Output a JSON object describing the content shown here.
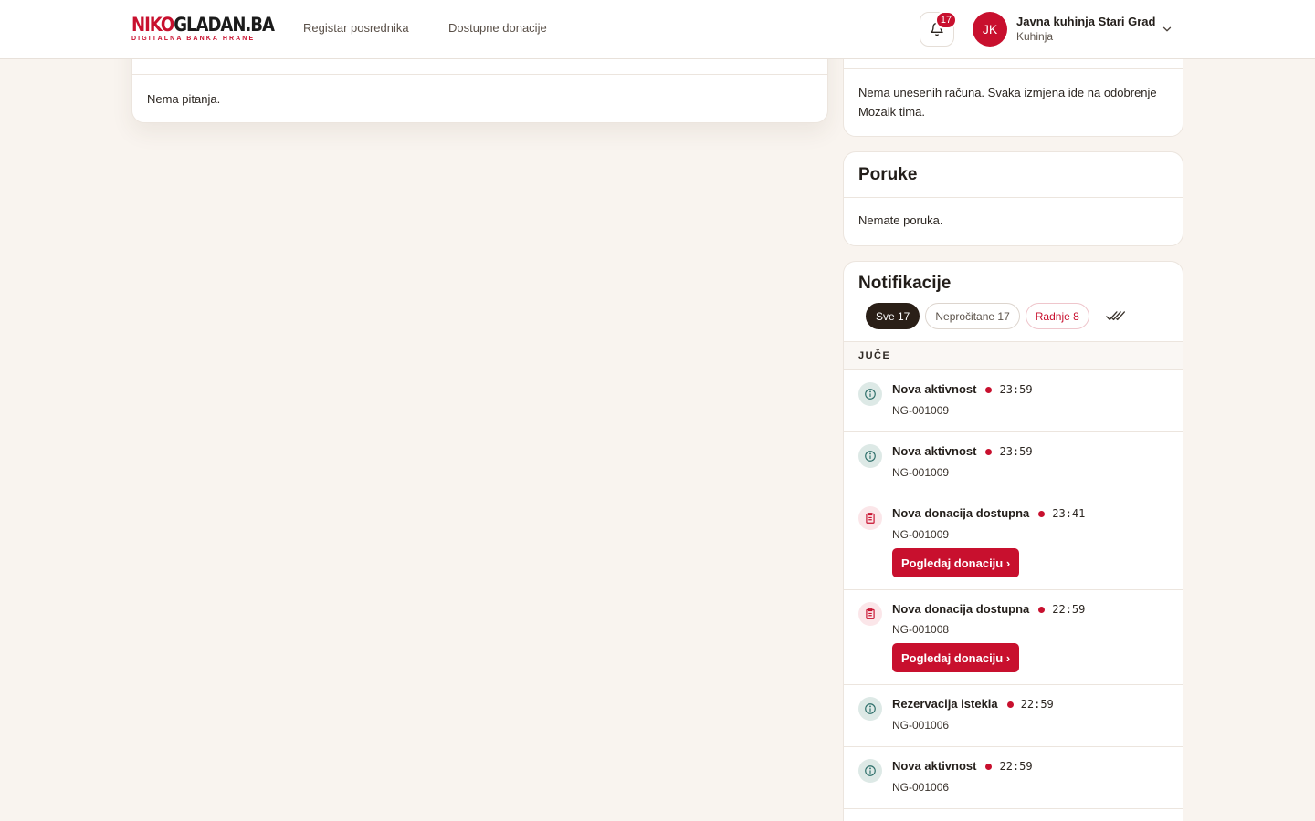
{
  "header": {
    "logo_primary": "NIKO",
    "logo_secondary": "GLADAN.BA",
    "logo_tagline": "DIGITALNA BANKA HRANE",
    "nav": [
      "Registar posrednika",
      "Dostupne donacije"
    ],
    "notification_count": "17",
    "user": {
      "initials": "JK",
      "name": "Javna kuhinja Stari Grad",
      "role": "Kuhinja"
    }
  },
  "questions": {
    "empty_text": "Nema pitanja."
  },
  "receipts": {
    "empty_text": "Nema unesenih računa. Svaka izmjena ide na odobrenje Mozaik tima."
  },
  "messages": {
    "title": "Poruke",
    "empty_text": "Nemate poruka."
  },
  "notifications": {
    "title": "Notifikacije",
    "tabs": [
      {
        "label": "Sve 17",
        "state": "active"
      },
      {
        "label": "Nepročitane 17",
        "state": "default"
      },
      {
        "label": "Radnje 8",
        "state": "urgent"
      }
    ],
    "group_label": "JUČE",
    "items": [
      {
        "icon": "info-icon",
        "title": "Nova aktivnost",
        "time": "23:59",
        "ref": "NG-001009"
      },
      {
        "icon": "info-icon",
        "title": "Nova aktivnost",
        "time": "23:59",
        "ref": "NG-001009"
      },
      {
        "icon": "clipboard-icon",
        "title": "Nova donacija dostupna",
        "time": "23:41",
        "ref": "NG-001009",
        "action": "Pogledaj donaciju ›"
      },
      {
        "icon": "clipboard-icon",
        "title": "Nova donacija dostupna",
        "time": "22:59",
        "ref": "NG-001008",
        "action": "Pogledaj donaciju ›"
      },
      {
        "icon": "info-icon",
        "title": "Rezervacija istekla",
        "time": "22:59",
        "ref": "NG-001006"
      },
      {
        "icon": "info-icon",
        "title": "Nova aktivnost",
        "time": "22:59",
        "ref": "NG-001006"
      }
    ]
  },
  "colors": {
    "accent": "#c8102e",
    "background": "#f9f4ef",
    "dark": "#2a1f17",
    "info_icon": "#2e6f6a"
  }
}
